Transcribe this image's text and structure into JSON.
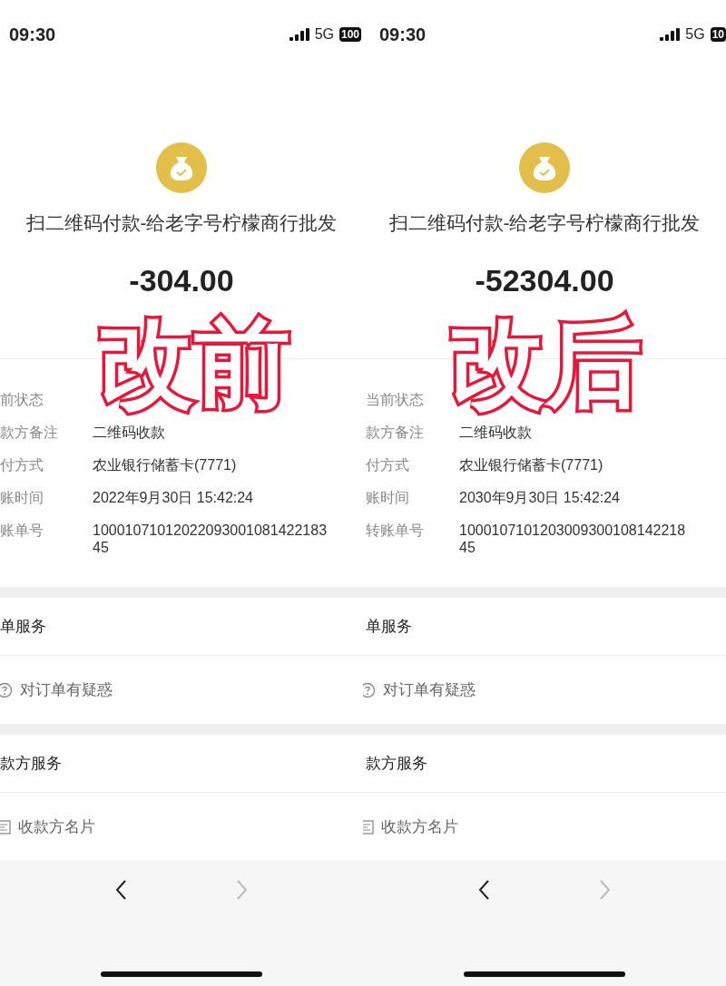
{
  "panels": [
    {
      "status_bar": {
        "time": "09:30",
        "network": "5G",
        "battery": "100"
      },
      "title": "扫二维码付款-给老字号柠檬商行批发",
      "amount": "-304.00",
      "overlay_label": "改前",
      "details": [
        {
          "label": "前状态"
        },
        {
          "label": "款方备注",
          "value_lines": [
            "二维码收款"
          ]
        },
        {
          "label": "付方式",
          "value_lines": [
            "农业银行储蓄卡(7771)"
          ]
        },
        {
          "label": "账时间",
          "value_lines": [
            "2022年9月30日 15:42:24"
          ]
        },
        {
          "label": "账单号",
          "value_lines": [
            "10001071012022093001081422183",
            "45"
          ]
        }
      ],
      "sections": [
        {
          "title": "单服务",
          "items": [
            {
              "kind": "question",
              "label": "对订单有疑惑"
            }
          ]
        },
        {
          "title": "款方服务",
          "items": [
            {
              "kind": "card",
              "label": "收款方名片"
            }
          ]
        }
      ],
      "nav": {
        "back_disabled": false,
        "forward_disabled": true
      }
    },
    {
      "status_bar": {
        "time": "09:30",
        "network": "5G",
        "battery": "10"
      },
      "title": "扫二维码付款-给老字号柠檬商行批发",
      "amount": "-52304.00",
      "overlay_label": "改后",
      "details": [
        {
          "label": "当前状态"
        },
        {
          "label": "款方备注",
          "value_lines": [
            "二维码收款"
          ]
        },
        {
          "label": "付方式",
          "value_lines": [
            "农业银行储蓄卡(7771)"
          ]
        },
        {
          "label": "账时间",
          "value_lines": [
            "2030年9月30日 15:42:24"
          ]
        },
        {
          "label": "转账单号",
          "value_lines": [
            "1000107101203009300108142218",
            "45"
          ]
        }
      ],
      "sections": [
        {
          "title": "单服务",
          "items": [
            {
              "kind": "question",
              "label": "对订单有疑惑"
            }
          ]
        },
        {
          "title": "款方服务",
          "items": [
            {
              "kind": "card",
              "label": "收款方名片"
            }
          ]
        }
      ],
      "nav": {
        "back_disabled": false,
        "forward_disabled": true
      }
    }
  ]
}
